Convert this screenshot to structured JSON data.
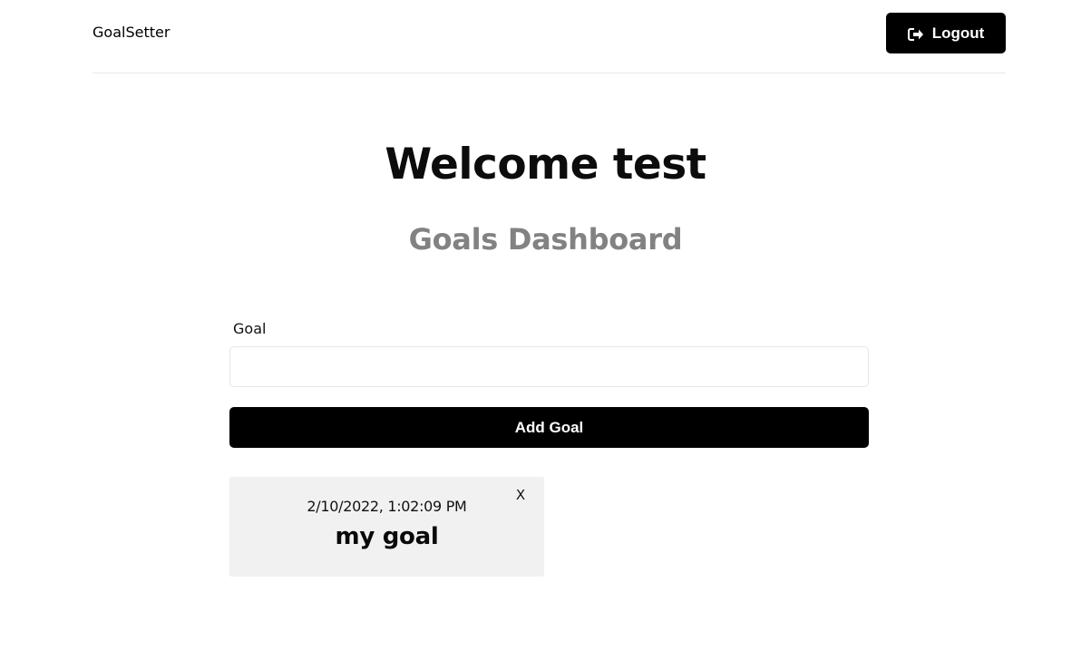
{
  "header": {
    "brand": "GoalSetter",
    "logout_label": "Logout",
    "logout_icon": "sign-out-icon"
  },
  "main": {
    "welcome": "Welcome test",
    "subtitle": "Goals Dashboard"
  },
  "form": {
    "goal_label": "Goal",
    "goal_value": "",
    "add_button_label": "Add Goal"
  },
  "goals": [
    {
      "date": "2/10/2022, 1:02:09 PM",
      "text": "my goal",
      "close_label": "X"
    }
  ],
  "colors": {
    "primary": "#000000",
    "subtitle": "#828282",
    "card_background": "#f1f1f1",
    "border": "#e6e6e6"
  }
}
